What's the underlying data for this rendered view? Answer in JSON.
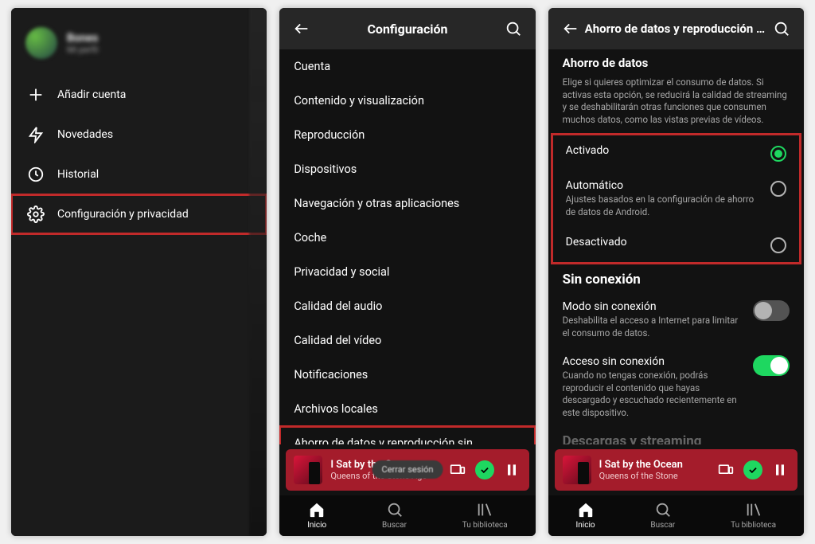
{
  "colors": {
    "accent": "#1ed760",
    "highlight": "#c12a2a",
    "player": "#a41c2b"
  },
  "phone1": {
    "profile": {
      "name": "Bones",
      "subtitle": "Mi perfil"
    },
    "menu": [
      {
        "icon": "plus",
        "label": "Añadir cuenta"
      },
      {
        "icon": "bolt",
        "label": "Novedades"
      },
      {
        "icon": "history",
        "label": "Historial"
      },
      {
        "icon": "gear",
        "label": "Configuración y privacidad",
        "highlight": true
      }
    ]
  },
  "phone2": {
    "title": "Configuración",
    "items": [
      "Cuenta",
      "Contenido y visualización",
      "Reproducción",
      "Dispositivos",
      "Navegación y otras aplicaciones",
      "Coche",
      "Privacidad y social",
      "Calidad del audio",
      "Calidad del vídeo",
      "Notificaciones",
      "Archivos locales"
    ],
    "highlighted_item": "Ahorro de datos y reproducción sin conexión",
    "overflow_pill": "Cerrar sesión"
  },
  "phone3": {
    "title": "Ahorro de datos y reproducción sin",
    "dataSaver": {
      "heading": "Ahorro de datos",
      "description": "Elige si quieres optimizar el consumo de datos. Si activas esta opción, se reducirá la calidad de streaming y se deshabilitarán otras funciones que consumen muchos datos, como las vistas previas de vídeos.",
      "options": [
        {
          "label": "Activado",
          "sub": "",
          "selected": true
        },
        {
          "label": "Automático",
          "sub": "Ajustes basados en la configuración de ahorro de datos de Android.",
          "selected": false
        },
        {
          "label": "Desactivado",
          "sub": "",
          "selected": false
        }
      ]
    },
    "offline": {
      "heading": "Sin conexión",
      "modeTitle": "Modo sin conexión",
      "modeDesc": "Deshabilita el acceso a Internet para limitar el consumo de datos.",
      "modeOn": false,
      "accessTitle": "Acceso sin conexión",
      "accessDesc": "Cuando no tengas conexión, podrás reproducir el contenido que hayas descargado y escuchado recientemente en este dispositivo.",
      "accessOn": true,
      "hiddenHeading": "Descargas y streaming"
    }
  },
  "player": {
    "track": "I Sat by the Ocean",
    "artist": "Queens of the Stone Age",
    "artist_trunc": "Queens of the Stone"
  },
  "nav": {
    "home": "Inicio",
    "search": "Buscar",
    "library": "Tu biblioteca"
  }
}
